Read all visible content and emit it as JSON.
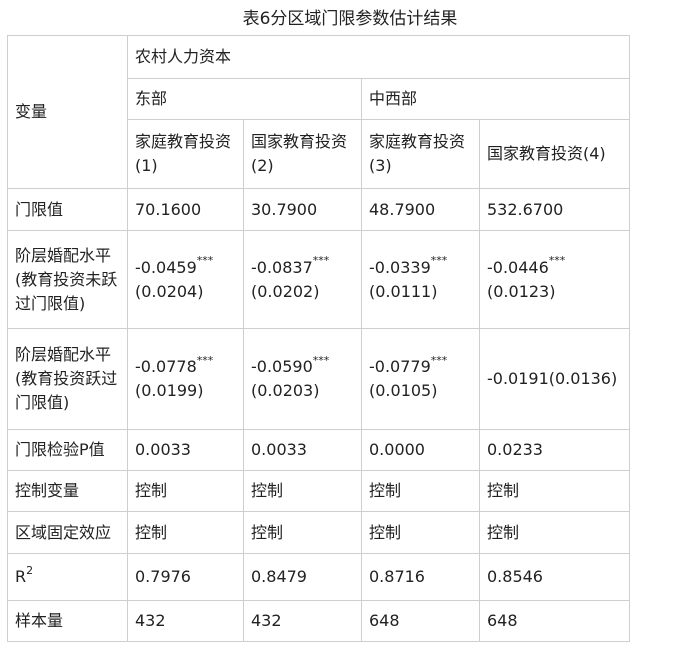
{
  "title": "表6分区域门限参数估计结果",
  "header": {
    "variable_label": "变量",
    "group_label": "农村人力资本",
    "region_east": "东部",
    "region_midwest": "中西部",
    "col1": [
      "家庭教育投资",
      "(1)"
    ],
    "col2": [
      "国家教育投资",
      "(2)"
    ],
    "col3": [
      "家庭教育投资",
      "(3)"
    ],
    "col4": "国家教育投资(4)"
  },
  "rows": {
    "threshold": {
      "label": "门限值",
      "values": [
        "70.1600",
        "30.7900",
        "48.7900",
        "532.6700"
      ]
    },
    "below": {
      "label": [
        "阶层婚配水平",
        "(教育投资未跃",
        "过门限值)"
      ],
      "coef": [
        "-0.0459",
        "-0.0837",
        "-0.0339",
        "-0.0446"
      ],
      "stars": [
        "***",
        "***",
        "***",
        "***"
      ],
      "se": [
        "(0.0204)",
        "(0.0202)",
        "(0.0111)",
        "(0.0123)"
      ]
    },
    "above": {
      "label": [
        "阶层婚配水平",
        "(教育投资跃过",
        "门限值)"
      ],
      "coef": [
        "-0.0778",
        "-0.0590",
        "-0.0779"
      ],
      "stars": [
        "***",
        "***",
        "***"
      ],
      "se": [
        "(0.0199)",
        "(0.0203)",
        "(0.0105)"
      ],
      "col4": "-0.0191(0.0136)"
    },
    "pvalue": {
      "label": "门限检验P值",
      "values": [
        "0.0033",
        "0.0033",
        "0.0000",
        "0.0233"
      ]
    },
    "controls": {
      "label": "控制变量",
      "values": [
        "控制",
        "控制",
        "控制",
        "控制"
      ]
    },
    "fixed": {
      "label": "区域固定效应",
      "values": [
        "控制",
        "控制",
        "控制",
        "控制"
      ]
    },
    "r2": {
      "label": "R",
      "label_sup": "2",
      "values": [
        "0.7976",
        "0.8479",
        "0.8716",
        "0.8546"
      ]
    },
    "n": {
      "label": "样本量",
      "values": [
        "432",
        "432",
        "648",
        "648"
      ]
    }
  }
}
